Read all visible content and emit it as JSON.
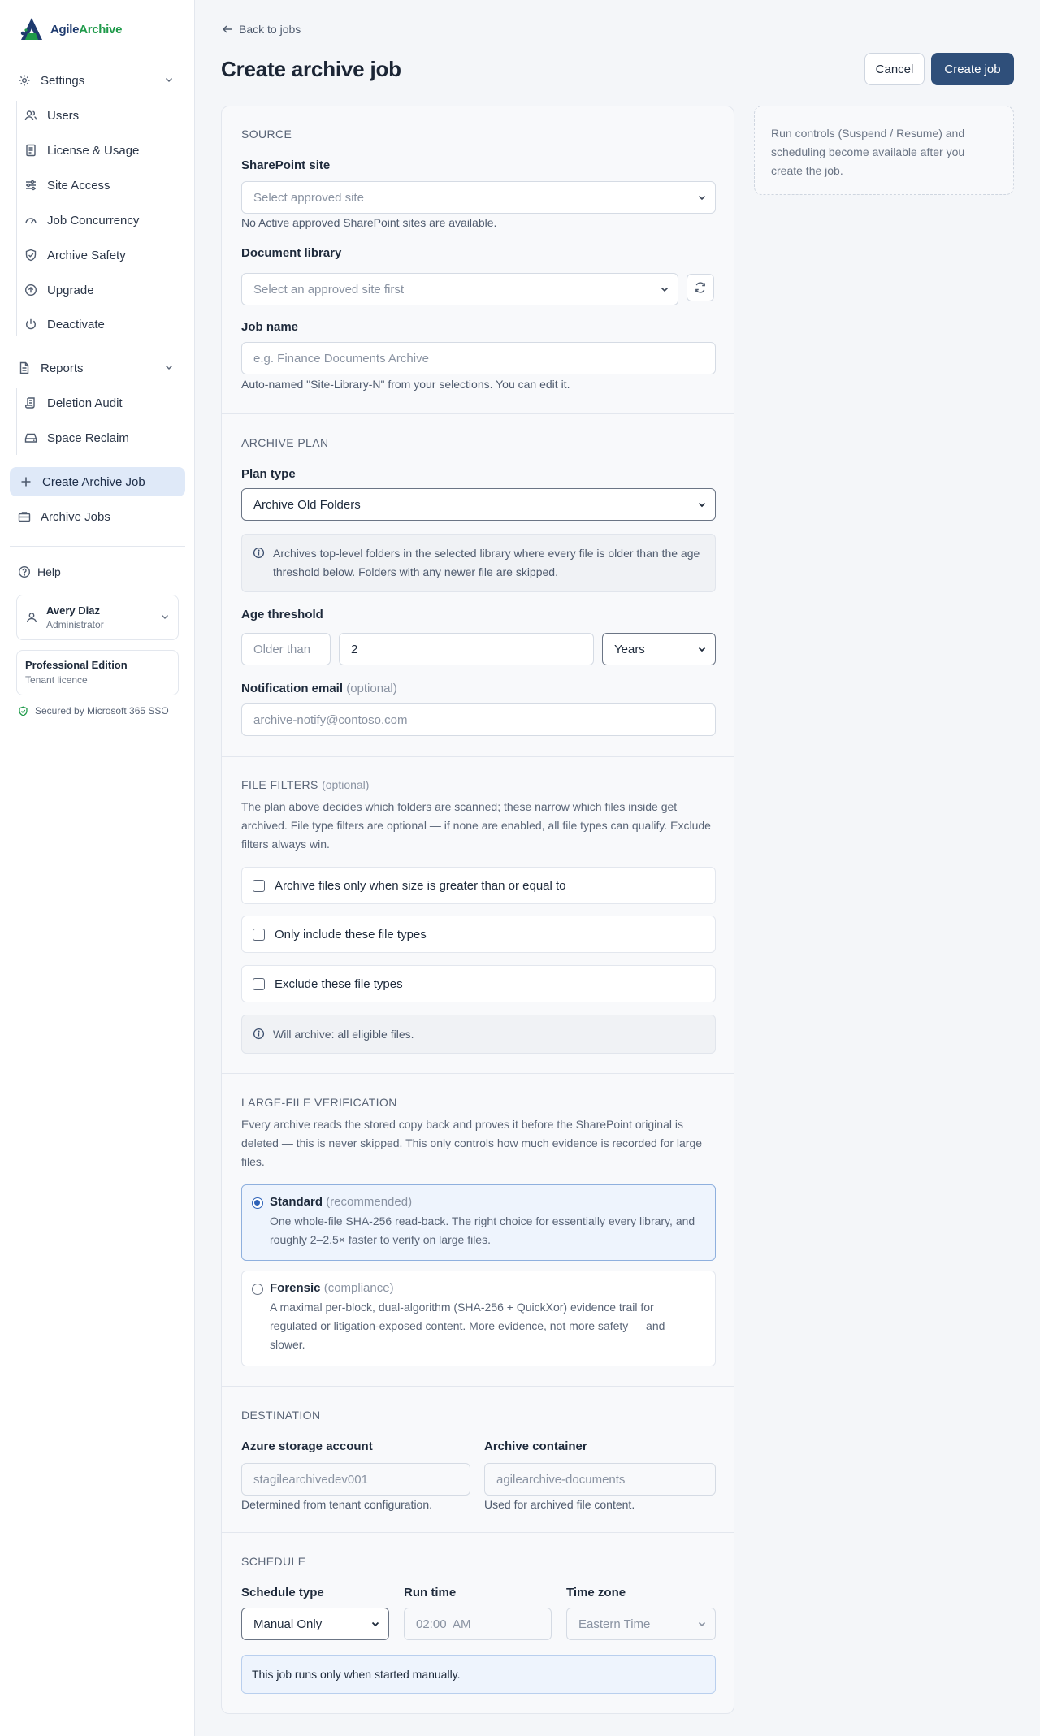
{
  "brand": {
    "name_a": "Agile",
    "name_b": "Archive"
  },
  "sidebar": {
    "settings_label": "Settings",
    "settings_items": [
      "Users",
      "License & Usage",
      "Site Access",
      "Job Concurrency",
      "Archive Safety",
      "Upgrade",
      "Deactivate"
    ],
    "reports_label": "Reports",
    "reports_items": [
      "Deletion Audit",
      "Space Reclaim"
    ],
    "create_job_label": "Create Archive Job",
    "archive_jobs_label": "Archive Jobs",
    "help_label": "Help",
    "user": {
      "name": "Avery Diaz",
      "role": "Administrator"
    },
    "edition": {
      "name": "Professional Edition",
      "sub": "Tenant licence"
    },
    "sso": "Secured by Microsoft 365 SSO"
  },
  "header": {
    "back": "Back to jobs",
    "title": "Create archive job",
    "cancel": "Cancel",
    "create": "Create job"
  },
  "side_note": "Run controls (Suspend / Resume) and scheduling become available after you create the job.",
  "source": {
    "title": "SOURCE",
    "site_label": "SharePoint site",
    "site_placeholder": "Select approved site",
    "site_hint": "No Active approved SharePoint sites are available.",
    "library_label": "Document library",
    "library_placeholder": "Select an approved site first",
    "job_name_label": "Job name",
    "job_name_placeholder": "e.g. Finance Documents Archive",
    "job_name_hint": "Auto-named \"Site-Library-N\" from your selections. You can edit it."
  },
  "plan": {
    "title": "ARCHIVE PLAN",
    "type_label": "Plan type",
    "type_value": "Archive Old Folders",
    "info": "Archives top-level folders in the selected library where every file is older than the age threshold below. Folders with any newer file are skipped.",
    "age_label": "Age threshold",
    "age_prefix": "Older than",
    "age_value": "2",
    "age_unit": "Years",
    "email_label": "Notification email",
    "email_optional": "(optional)",
    "email_placeholder": "archive-notify@contoso.com"
  },
  "filters": {
    "title": "FILE FILTERS",
    "optional": "(optional)",
    "desc": "The plan above decides which folders are scanned; these narrow which files inside get archived. File type filters are optional — if none are enabled, all file types can qualify. Exclude filters always win.",
    "size_filter": "Archive files only when size is greater than or equal to",
    "include_types": "Only include these file types",
    "exclude_types": "Exclude these file types",
    "summary": "Will archive: all eligible files."
  },
  "verification": {
    "title": "LARGE-FILE VERIFICATION",
    "desc": "Every archive reads the stored copy back and proves it before the SharePoint original is deleted — this is never skipped. This only controls how much evidence is recorded for large files.",
    "standard_title": "Standard",
    "standard_tag": "(recommended)",
    "standard_body": "One whole-file SHA-256 read-back. The right choice for essentially every library, and roughly 2–2.5× faster to verify on large files.",
    "forensic_title": "Forensic",
    "forensic_tag": "(compliance)",
    "forensic_body": "A maximal per-block, dual-algorithm (SHA-256 + QuickXor) evidence trail for regulated or litigation-exposed content. More evidence, not more safety — and slower."
  },
  "destination": {
    "title": "DESTINATION",
    "account_label": "Azure storage account",
    "account_value": "stagilearchivedev001",
    "account_hint": "Determined from tenant configuration.",
    "container_label": "Archive container",
    "container_value": "agilearchive-documents",
    "container_hint": "Used for archived file content."
  },
  "schedule": {
    "title": "SCHEDULE",
    "type_label": "Schedule type",
    "type_value": "Manual Only",
    "time_label": "Run time",
    "time_value": "02:00  AM",
    "tz_label": "Time zone",
    "tz_value": "Eastern Time",
    "note": "This job runs only when started manually."
  }
}
